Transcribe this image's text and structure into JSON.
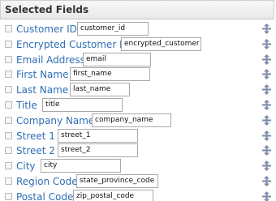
{
  "panel": {
    "title": "Selected Fields"
  },
  "fields": [
    {
      "label": "Customer ID",
      "value": "customer_id"
    },
    {
      "label": "Encrypted Customer ID",
      "value": "encrypted_customer"
    },
    {
      "label": "Email Address",
      "value": "email"
    },
    {
      "label": "First Name",
      "value": "first_name"
    },
    {
      "label": "Last Name",
      "value": "last_name"
    },
    {
      "label": "Title",
      "value": "title"
    },
    {
      "label": "Company Name",
      "value": "company_name"
    },
    {
      "label": "Street 1",
      "value": "street_1"
    },
    {
      "label": "Street 2",
      "value": "street_2"
    },
    {
      "label": "City",
      "value": "city"
    },
    {
      "label": "Region Code",
      "value": "state_province_code"
    },
    {
      "label": "Postal Code",
      "value": "zip_postal_code"
    }
  ],
  "colors": {
    "label": "#2f6fb5",
    "handle": "#7a8aa8"
  },
  "icons": {
    "row_handle": "move-arrows-icon",
    "row_checkbox": "checkbox"
  }
}
